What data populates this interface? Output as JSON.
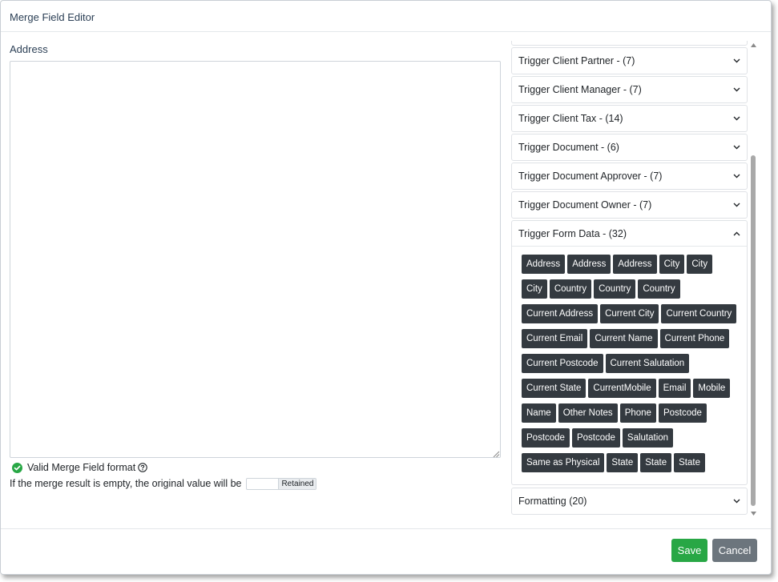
{
  "dialog": {
    "title": "Merge Field Editor"
  },
  "editor": {
    "label": "Address",
    "value": "",
    "valid_message": "Valid Merge Field format",
    "empty_message": "If the merge result is empty, the original value will be",
    "empty_option": "Retained"
  },
  "icons": {
    "valid": "check-circle-icon",
    "help": "question-circle-icon"
  },
  "colors": {
    "valid": "#28a745",
    "tag_bg": "#343a40",
    "save": "#28a745",
    "cancel": "#6c757d",
    "title": "#2b3f55"
  },
  "fields_panel": {
    "sections": [
      {
        "label": "Trigger Client Partner - (7)",
        "expanded": false
      },
      {
        "label": "Trigger Client Manager - (7)",
        "expanded": false
      },
      {
        "label": "Trigger Client Tax - (14)",
        "expanded": false
      },
      {
        "label": "Trigger Document - (6)",
        "expanded": false
      },
      {
        "label": "Trigger Document Approver - (7)",
        "expanded": false
      },
      {
        "label": "Trigger Document Owner - (7)",
        "expanded": false
      },
      {
        "label": "Trigger Form Data - (32)",
        "expanded": true
      },
      {
        "label": "Formatting (20)",
        "expanded": false
      }
    ],
    "form_data_fields": [
      "Address",
      "Address",
      "Address",
      "City",
      "City",
      "City",
      "Country",
      "Country",
      "Country",
      "Current Address",
      "Current City",
      "Current Country",
      "Current Email",
      "Current Name",
      "Current Phone",
      "Current Postcode",
      "Current Salutation",
      "Current State",
      "CurrentMobile",
      "Email",
      "Mobile",
      "Name",
      "Other Notes",
      "Phone",
      "Postcode",
      "Postcode",
      "Postcode",
      "Salutation",
      "Same as Physical",
      "State",
      "State",
      "State"
    ]
  },
  "footer": {
    "save_label": "Save",
    "cancel_label": "Cancel"
  }
}
